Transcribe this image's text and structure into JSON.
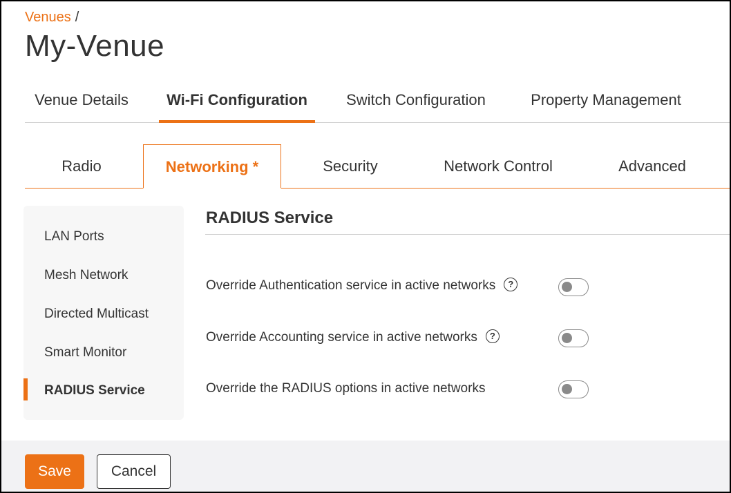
{
  "breadcrumb": {
    "link": "Venues",
    "separator": "/"
  },
  "page_title": "My-Venue",
  "main_tabs": [
    {
      "label": "Venue Details",
      "active": false
    },
    {
      "label": "Wi-Fi Configuration",
      "active": true
    },
    {
      "label": "Switch Configuration",
      "active": false
    },
    {
      "label": "Property Management",
      "active": false
    }
  ],
  "sub_tabs": [
    {
      "label": "Radio",
      "active": false
    },
    {
      "label": "Networking *",
      "active": true
    },
    {
      "label": "Security",
      "active": false
    },
    {
      "label": "Network Control",
      "active": false
    },
    {
      "label": "Advanced",
      "active": false
    }
  ],
  "side_nav": [
    {
      "label": "LAN Ports",
      "active": false
    },
    {
      "label": "Mesh Network",
      "active": false
    },
    {
      "label": "Directed Multicast",
      "active": false
    },
    {
      "label": "Smart Monitor",
      "active": false
    },
    {
      "label": "RADIUS Service",
      "active": true
    }
  ],
  "section": {
    "title": "RADIUS Service",
    "settings": [
      {
        "label": "Override Authentication service in active networks",
        "help": true,
        "help_glyph": "?",
        "enabled": false
      },
      {
        "label": "Override Accounting service in active networks",
        "help": true,
        "help_glyph": "?",
        "enabled": false
      },
      {
        "label": "Override the RADIUS options in active networks",
        "help": false,
        "enabled": false
      }
    ]
  },
  "footer": {
    "save_label": "Save",
    "cancel_label": "Cancel"
  },
  "colors": {
    "accent": "#ec7116",
    "text": "#333333",
    "footer_bg": "#f2f2f4",
    "nav_bg": "#f7f7f7"
  },
  "icons": {
    "help": "help-circle-icon"
  }
}
